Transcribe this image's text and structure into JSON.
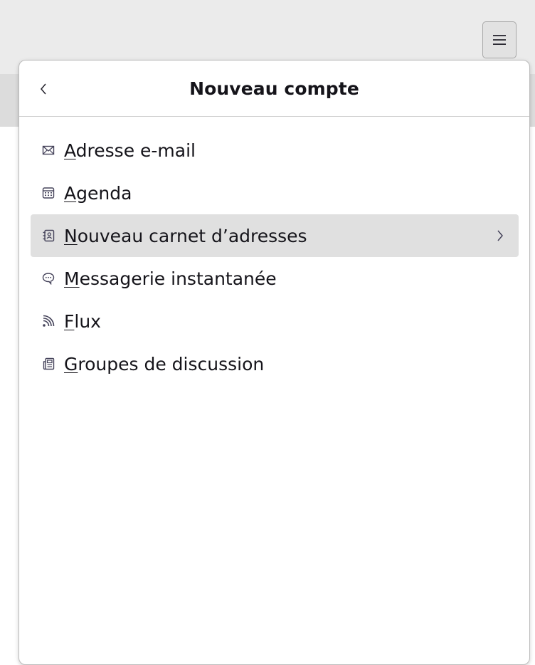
{
  "window": {
    "menu_button_icon": "hamburger-menu-icon"
  },
  "panel": {
    "title": "Nouveau compte",
    "back_icon": "chevron-left-icon"
  },
  "menu": {
    "items": [
      {
        "accesskey": "A",
        "rest": "dresse e-mail",
        "icon": "envelope-icon",
        "has_submenu": false
      },
      {
        "accesskey": "A",
        "rest": "genda",
        "icon": "calendar-icon",
        "has_submenu": false
      },
      {
        "accesskey": "N",
        "rest": "ouveau carnet d’adresses",
        "icon": "address-book-icon",
        "has_submenu": true,
        "highlighted": true,
        "submenu_icon": "chevron-right-icon"
      },
      {
        "accesskey": "M",
        "rest": "essagerie instantanée",
        "icon": "chat-bubble-icon",
        "has_submenu": false
      },
      {
        "accesskey": "F",
        "rest": "lux",
        "icon": "rss-feed-icon",
        "has_submenu": false
      },
      {
        "accesskey": "G",
        "rest": "roupes de discussion",
        "icon": "newsgroup-icon",
        "has_submenu": false
      }
    ]
  },
  "colors": {
    "text": "#15141a",
    "highlight": "#e0e0e0",
    "window_bg": "#ebebeb",
    "icon": "#45435a"
  }
}
